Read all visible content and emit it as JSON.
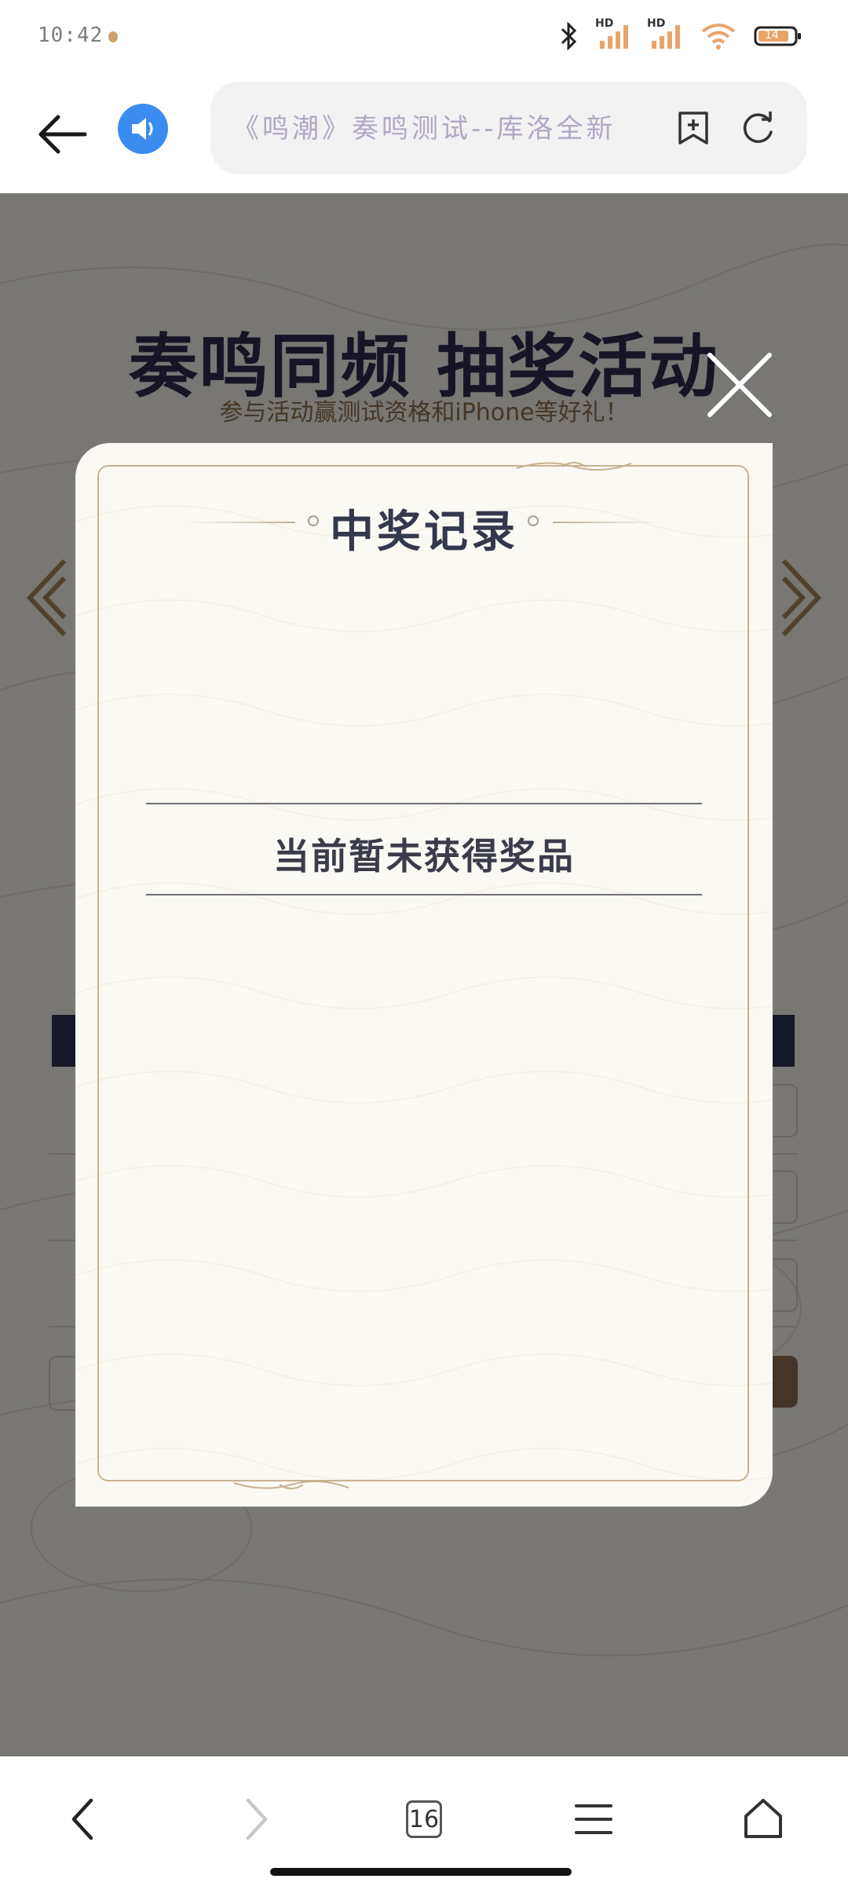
{
  "status_bar": {
    "time": "10:42",
    "icons": [
      "bluetooth-icon",
      "signal-hd-icon",
      "signal-hd-icon",
      "wifi-icon",
      "battery-icon"
    ],
    "network_badges": [
      "HD",
      "HD"
    ],
    "battery_level": "14"
  },
  "browser": {
    "url_title": "《鸣潮》奏鸣测试--库洛全新",
    "accent_color": "#3b8cf0"
  },
  "page": {
    "hero_title": "奏鸣同频 抽奖活动",
    "hero_subtitle": "参与活动赢测试资格和iPhone等好礼！"
  },
  "modal": {
    "title": "中奖记录",
    "empty_message": "当前暂未获得奖品"
  },
  "bottom_nav": {
    "tab_count": "16"
  }
}
